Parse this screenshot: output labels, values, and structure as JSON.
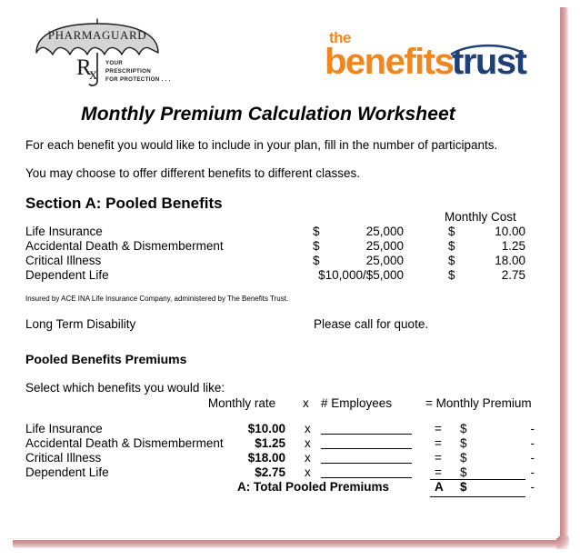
{
  "page": {
    "frame_color": "#c98a8f",
    "background": "#ffffff"
  },
  "header": {
    "left_logo": {
      "name": "pharmaguard-logo",
      "brand": "PHARMAGUARD",
      "rx_symbol": "Rx",
      "tagline_lines": [
        "YOUR",
        "PRESCRIPTION",
        "FOR PROTECTION . . ."
      ],
      "umbrella_fill": "#d4d4d4"
    },
    "right_logo": {
      "name": "benefits-trust-logo",
      "the": "the",
      "benefits": "benefits",
      "trust": "trust",
      "orange": "#f0861f",
      "navy": "#1f3f77"
    }
  },
  "title": "Monthly Premium Calculation Worksheet",
  "intro": {
    "line1": "For each benefit you would like to include in your plan, fill in the number of participants.",
    "line2": "You may choose to offer different benefits to different classes."
  },
  "section_a": {
    "heading": "Section A:  Pooled Benefits",
    "cost_column_header": "Monthly Cost",
    "rows": [
      {
        "benefit": "Life Insurance",
        "amount_symbol": "$",
        "amount": "25,000",
        "amount_combined": "",
        "cost_symbol": "$",
        "cost": "10.00"
      },
      {
        "benefit": "Accidental Death & Dismemberment",
        "amount_symbol": "$",
        "amount": "25,000",
        "amount_combined": "",
        "cost_symbol": "$",
        "cost": "1.25"
      },
      {
        "benefit": "Critical Illness",
        "amount_symbol": "$",
        "amount": "25,000",
        "amount_combined": "",
        "cost_symbol": "$",
        "cost": "18.00"
      },
      {
        "benefit": "Dependent Life",
        "amount_symbol": "",
        "amount": "",
        "amount_combined": "$10,000/$5,000",
        "cost_symbol": "$",
        "cost": "2.75"
      }
    ],
    "insured_note": "Insured by ACE INA Life Insurance Company, administered by The Benefits Trust.",
    "ltd_label": "Long Term Disability",
    "ltd_value": "Please call for quote."
  },
  "pooled_premiums": {
    "heading": "Pooled Benefits Premiums",
    "select_label": "Select which benefits you would like:",
    "columns": {
      "rate": "Monthly rate",
      "times": "x",
      "employees": "# Employees",
      "premium": "= Monthly Premium"
    },
    "rows": [
      {
        "benefit": "Life Insurance",
        "rate": "$10.00",
        "times": "x",
        "employees": "",
        "equals": "=",
        "premium_symbol": "$",
        "premium": "-"
      },
      {
        "benefit": "Accidental Death & Dismemberment",
        "rate": "$1.25",
        "times": "x",
        "employees": "",
        "equals": "=",
        "premium_symbol": "$",
        "premium": "-"
      },
      {
        "benefit": "Critical Illness",
        "rate": "$18.00",
        "times": "x",
        "employees": "",
        "equals": "=",
        "premium_symbol": "$",
        "premium": "-"
      },
      {
        "benefit": "Dependent Life",
        "rate": "$2.75",
        "times": "x",
        "employees": "",
        "equals": "=",
        "premium_symbol": "$",
        "premium": "-"
      }
    ],
    "total": {
      "label": "A: Total Pooled Premiums",
      "code": "A",
      "symbol": "$",
      "value": "-"
    }
  }
}
